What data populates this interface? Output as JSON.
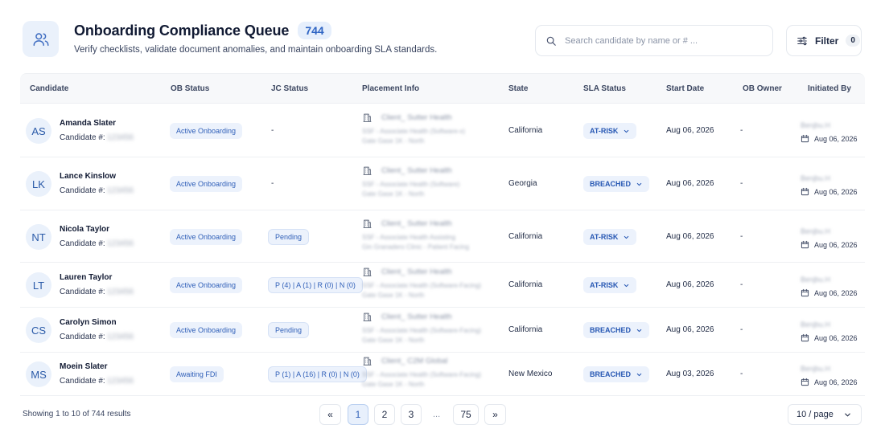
{
  "header": {
    "title": "Onboarding Compliance Queue",
    "count": "744",
    "subtitle": "Verify checklists, validate document anomalies, and maintain onboarding SLA standards.",
    "icon": "users-icon"
  },
  "search": {
    "placeholder": "Search candidate by name or # ...",
    "value": ""
  },
  "filter": {
    "label": "Filter",
    "count": "0"
  },
  "columns": [
    "Candidate",
    "OB Status",
    "JC Status",
    "Placement Info",
    "State",
    "SLA Status",
    "Start Date",
    "OB Owner",
    "Initiated By"
  ],
  "rows": [
    {
      "initials": "AS",
      "name": "Amanda Slater",
      "num_label": "Candidate #:",
      "num": "123456",
      "ob_status": "Active Onboarding",
      "jc_status": "-",
      "jc_is_pill": false,
      "placement": {
        "client": "Client_ Sutter Health",
        "line2": "SSF - Associate Health (Software-x)",
        "line3": "Gate Gase 1K - North"
      },
      "state": "California",
      "sla": "AT-RISK",
      "start_date": "Aug 06, 2026",
      "ob_owner": "-",
      "initiated_by": "Benjbu.H",
      "initiated_date": "Aug 06, 2026"
    },
    {
      "initials": "LK",
      "name": "Lance Kinslow",
      "num_label": "Candidate #:",
      "num": "123456",
      "ob_status": "Active Onboarding",
      "jc_status": "-",
      "jc_is_pill": false,
      "placement": {
        "client": "Client_ Sutter Health",
        "line2": "SSF - Associate Health (Software)",
        "line3": "Gate Gase 1K - North"
      },
      "state": "Georgia",
      "sla": "BREACHED",
      "start_date": "Aug 06, 2026",
      "ob_owner": "-",
      "initiated_by": "Benjbu.H",
      "initiated_date": "Aug 06, 2026"
    },
    {
      "initials": "NT",
      "name": "Nicola Taylor",
      "num_label": "Candidate #:",
      "num": "123456",
      "ob_status": "Active Onboarding",
      "jc_status": "Pending",
      "jc_is_pill": true,
      "placement": {
        "client": "Client_ Sutter Health",
        "line2": "SSF - Associate Health Assisting",
        "line3": "Gin Granadero Clinic - Patient Facing"
      },
      "state": "California",
      "sla": "AT-RISK",
      "start_date": "Aug 06, 2026",
      "ob_owner": "-",
      "initiated_by": "Benjbu.H",
      "initiated_date": "Aug 06, 2026"
    },
    {
      "initials": "LT",
      "name": "Lauren Taylor",
      "num_label": "Candidate #:",
      "num": "123456",
      "ob_status": "Active Onboarding",
      "jc_status": "P (4) | A (1) | R (0) | N (0)",
      "jc_is_pill": true,
      "placement": {
        "client": "Client_ Sutter Health",
        "line2": "SSF - Associate Health (Software-Facing)",
        "line3": "Gate Gase 1K - North"
      },
      "state": "California",
      "sla": "AT-RISK",
      "start_date": "Aug 06, 2026",
      "ob_owner": "-",
      "initiated_by": "Benjbu.H",
      "initiated_date": "Aug 06, 2026"
    },
    {
      "initials": "CS",
      "name": "Carolyn Simon",
      "num_label": "Candidate #:",
      "num": "123456",
      "ob_status": "Active Onboarding",
      "jc_status": "Pending",
      "jc_is_pill": true,
      "placement": {
        "client": "Client_ Sutter Health",
        "line2": "SSF - Associate Health (Software-Facing)",
        "line3": "Gate Gase 1K - North"
      },
      "state": "California",
      "sla": "BREACHED",
      "start_date": "Aug 06, 2026",
      "ob_owner": "-",
      "initiated_by": "Benjbu.H",
      "initiated_date": "Aug 06, 2026"
    },
    {
      "initials": "MS",
      "name": "Moein Slater",
      "num_label": "Candidate #:",
      "num": "123456",
      "ob_status": "Awaiting FDI",
      "jc_status": "P (1) | A (16) | R (0) | N (0)",
      "jc_is_pill": true,
      "placement": {
        "client": "Client_ C2M Global",
        "line2": "SSF - Associate Health (Software-Facing)",
        "line3": "Gate Gase 1K - North"
      },
      "state": "New Mexico",
      "sla": "BREACHED",
      "start_date": "Aug 03, 2026",
      "ob_owner": "-",
      "initiated_by": "Benjbu.H",
      "initiated_date": "Aug 06, 2026"
    }
  ],
  "footer": {
    "showing": "Showing 1 to 10 of 744 results",
    "prev": "«",
    "next": "»",
    "pages": [
      "1",
      "2",
      "3"
    ],
    "ellipsis": "...",
    "last_page": "75",
    "current_page": "1",
    "per_page": "10 / page"
  },
  "colors": {
    "accent": "#2f5fb8",
    "pill_bg": "#ecf2fc",
    "header_bg": "#f7f8fa"
  }
}
